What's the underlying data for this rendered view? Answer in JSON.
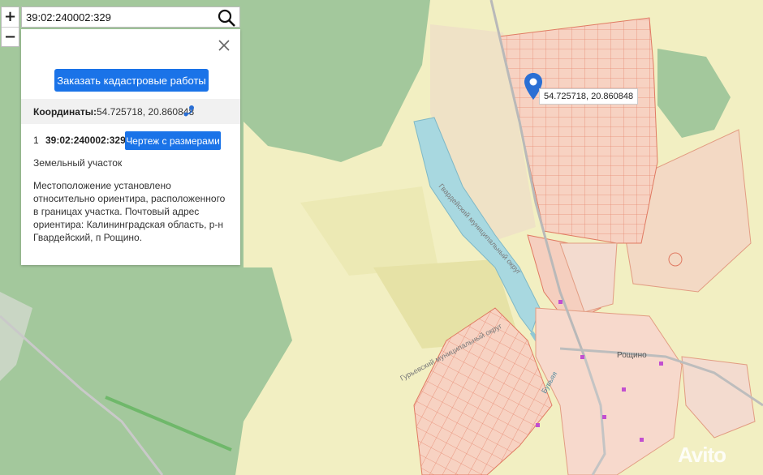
{
  "search": {
    "value": "39:02:240002:329"
  },
  "zoom": {
    "in_label": "+",
    "out_label": "−"
  },
  "panel": {
    "order_button": "Заказать кадастровые работы",
    "coords_label": "Координаты:",
    "coords_value": "54.725718, 20.860848",
    "row_index": "1",
    "cadastral_number": "39:02:240002:329",
    "drawing_button": "Чертеж с размерами",
    "parcel_type": "Земельный участок",
    "description": "Местоположение установлено относительно ориентира, расположенного в границах участка. Почтовый адрес ориентира: Калининградская область, р-н Гвардейский, п Рощино."
  },
  "marker": {
    "label": "54.725718, 20.860848"
  },
  "map_labels": {
    "district_1": "Гвардейский муниципальный округ",
    "district_2": "Гурьевский муниципальный округ",
    "river": "Бувьяя",
    "village": "Рощино"
  },
  "watermark": "Avito",
  "colors": {
    "forest": "#9fc59a",
    "fields": "#f2efc2",
    "water": "#a8d8e0",
    "parcels": "#f6cbb8",
    "parcel_lines": "#e8806a",
    "accent": "#1a73e8",
    "pin": "#2a6fd4"
  }
}
